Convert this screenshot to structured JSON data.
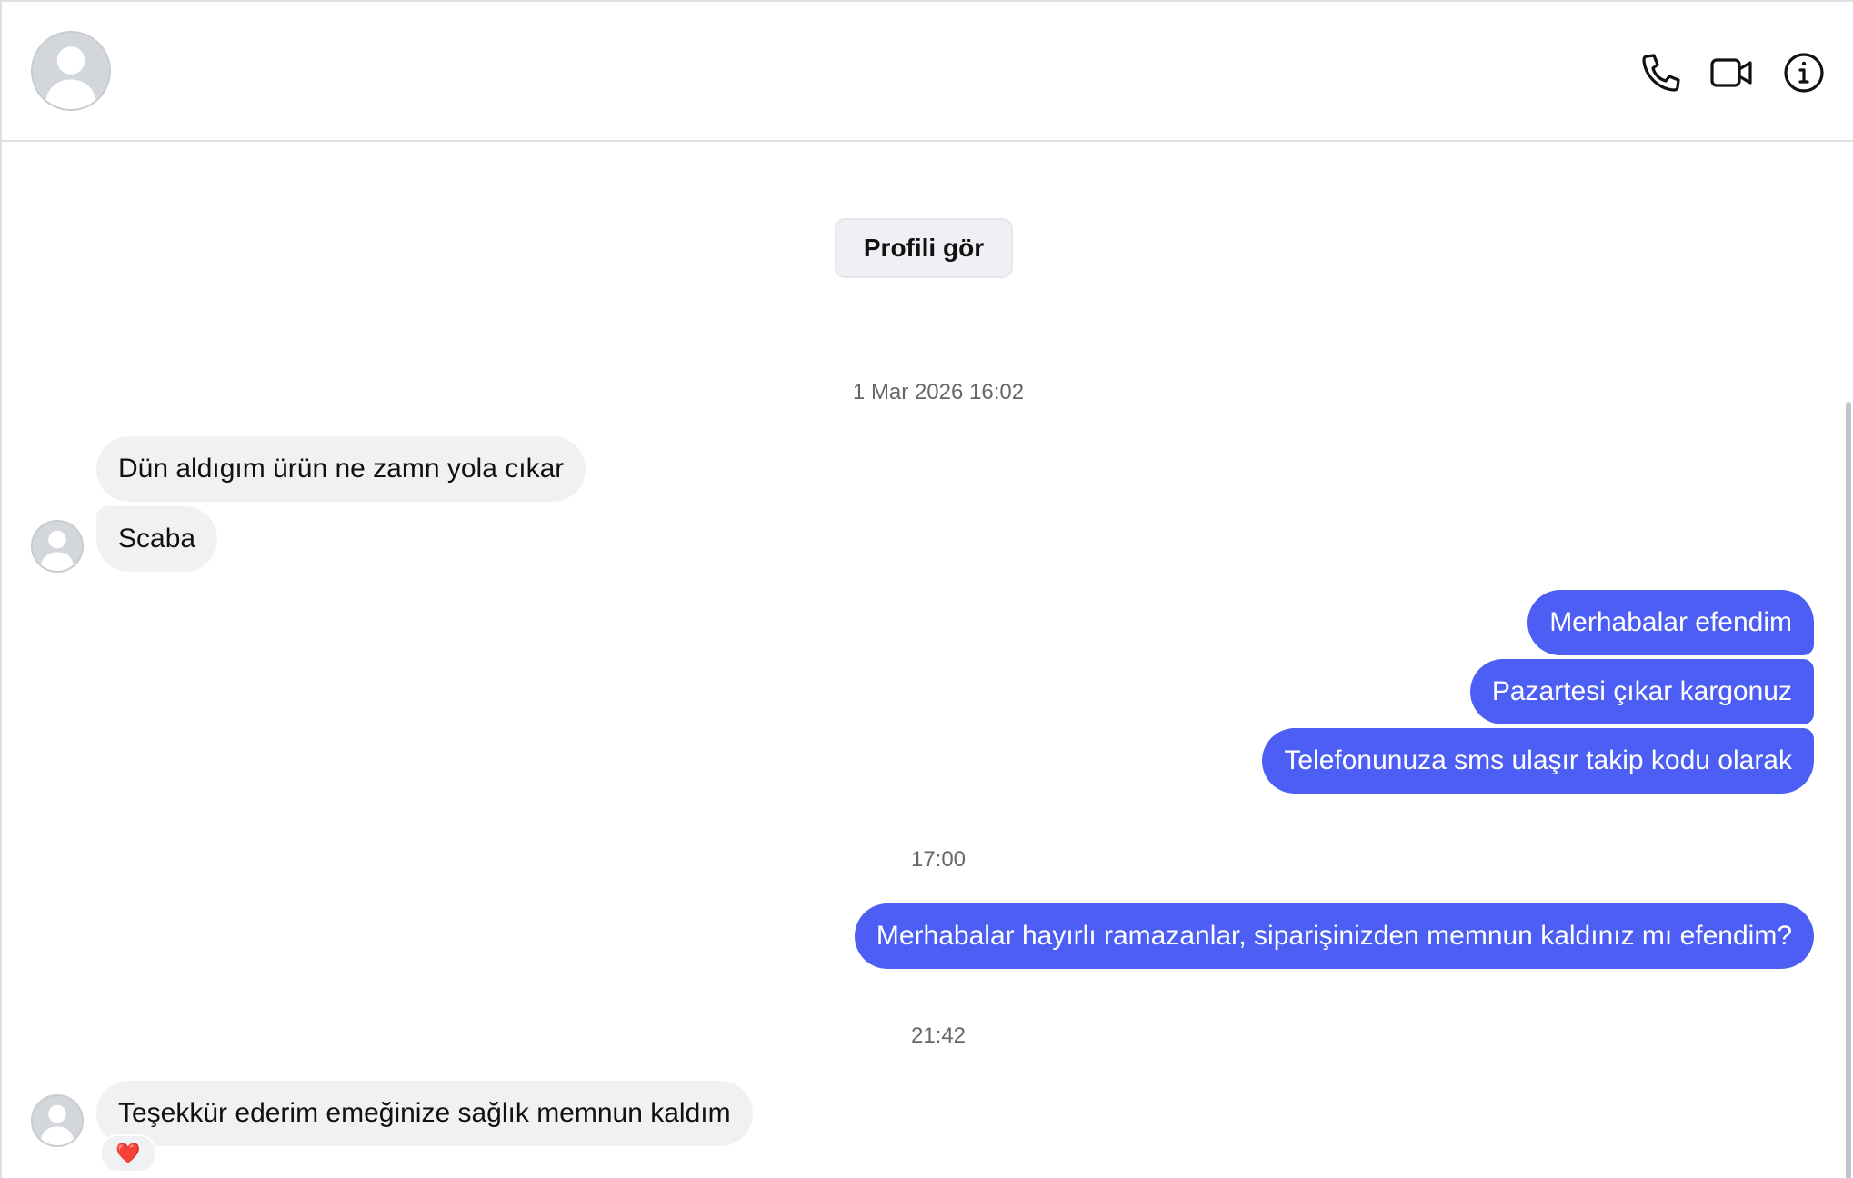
{
  "header": {
    "icons": {
      "phone": "phone-icon",
      "video": "video-camera-icon",
      "info": "info-icon"
    }
  },
  "profile_button": {
    "label": "Profili gör"
  },
  "timestamps": {
    "first": "1 Mar 2026 16:02",
    "second": "17:00",
    "third": "21:42"
  },
  "messages": [
    {
      "side": "incoming",
      "text": "Dün aldıgım ürün ne zamn yola cıkar"
    },
    {
      "side": "incoming",
      "text": "Scaba"
    },
    {
      "side": "outgoing",
      "text": "Merhabalar efendim"
    },
    {
      "side": "outgoing",
      "text": "Pazartesi çıkar kargonuz"
    },
    {
      "side": "outgoing",
      "text": "Telefonunuza sms ulaşır takip kodu olarak"
    },
    {
      "side": "outgoing",
      "text": "Merhabalar hayırlı ramazanlar, siparişinizden memnun kaldınız mı efendim?"
    },
    {
      "side": "incoming",
      "text": "Teşekkür ederim emeğinize sağlık memnun kaldım"
    }
  ],
  "reaction": {
    "emoji": "❤️"
  },
  "colors": {
    "outgoing_bubble": "#4c5ef3",
    "incoming_bubble": "#f0f1f3",
    "timestamp": "#65676b"
  }
}
